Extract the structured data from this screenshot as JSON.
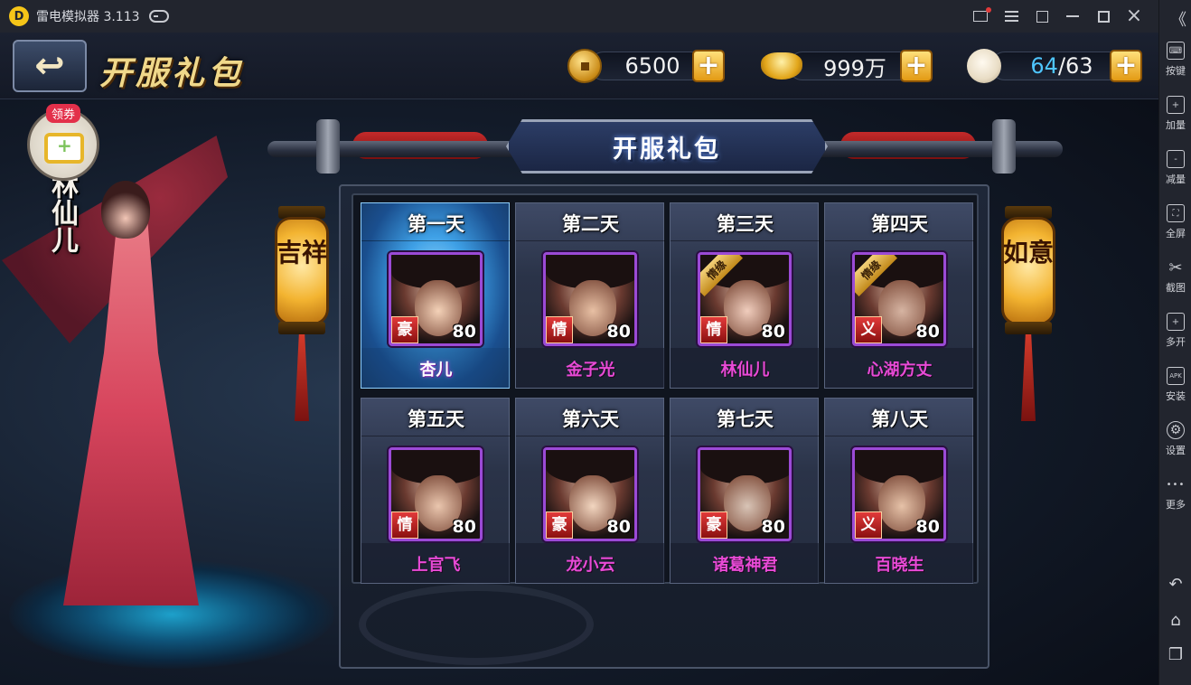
{
  "emulator": {
    "logo_glyph": "D",
    "title": "雷电模拟器 3.113",
    "sidebar": {
      "collapse": "《",
      "items": [
        {
          "label": "按键",
          "icon": "keyboard-icon",
          "glyph": "⌨"
        },
        {
          "label": "加量",
          "icon": "volume-up-icon",
          "glyph": "+"
        },
        {
          "label": "减量",
          "icon": "volume-down-icon",
          "glyph": "-"
        },
        {
          "label": "全屏",
          "icon": "fullscreen-icon",
          "glyph": "⛶"
        },
        {
          "label": "截图",
          "icon": "scissors-icon",
          "glyph": "✂"
        },
        {
          "label": "多开",
          "icon": "multi-instance-icon",
          "glyph": "+"
        },
        {
          "label": "安装",
          "icon": "apk-install-icon",
          "glyph": "APK"
        },
        {
          "label": "设置",
          "icon": "gear-icon",
          "glyph": "⚙"
        },
        {
          "label": "更多",
          "icon": "more-dots-icon",
          "glyph": "•••"
        }
      ],
      "nav": {
        "back": "↶",
        "home": "⌂",
        "recents": "❐"
      }
    }
  },
  "game": {
    "page_title": "开服礼包",
    "back_arrow": "↩",
    "resources": {
      "copper": "6500",
      "gold": "999万",
      "stamina_current": "64",
      "stamina_max": "/63"
    },
    "plus_label": "+",
    "character": {
      "name": "林仙儿",
      "coupon_tag": "领券"
    },
    "header_title": "开服礼包",
    "lanterns": {
      "left": "吉祥",
      "right": "如意"
    },
    "qingyuan_label": "情缘",
    "cards": [
      {
        "day": "第一天",
        "hero": "杏儿",
        "badge": "豪",
        "level": "80",
        "qingyuan": false,
        "active": true
      },
      {
        "day": "第二天",
        "hero": "金子光",
        "badge": "情",
        "level": "80",
        "qingyuan": false,
        "active": false
      },
      {
        "day": "第三天",
        "hero": "林仙儿",
        "badge": "情",
        "level": "80",
        "qingyuan": true,
        "active": false
      },
      {
        "day": "第四天",
        "hero": "心湖方丈",
        "badge": "义",
        "level": "80",
        "qingyuan": true,
        "active": false
      },
      {
        "day": "第五天",
        "hero": "上官飞",
        "badge": "情",
        "level": "80",
        "qingyuan": false,
        "active": false
      },
      {
        "day": "第六天",
        "hero": "龙小云",
        "badge": "豪",
        "level": "80",
        "qingyuan": false,
        "active": false
      },
      {
        "day": "第七天",
        "hero": "诸葛神君",
        "badge": "豪",
        "level": "80",
        "qingyuan": false,
        "active": false
      },
      {
        "day": "第八天",
        "hero": "百晓生",
        "badge": "义",
        "level": "80",
        "qingyuan": false,
        "active": false
      }
    ],
    "colors": {
      "hero_name": "#e84ad6",
      "title_gold": "#f0d88a",
      "stamina_blue": "#4fc6ff",
      "frame_purple": "#9b4ad6",
      "badge_red": "#e23a3a"
    }
  }
}
